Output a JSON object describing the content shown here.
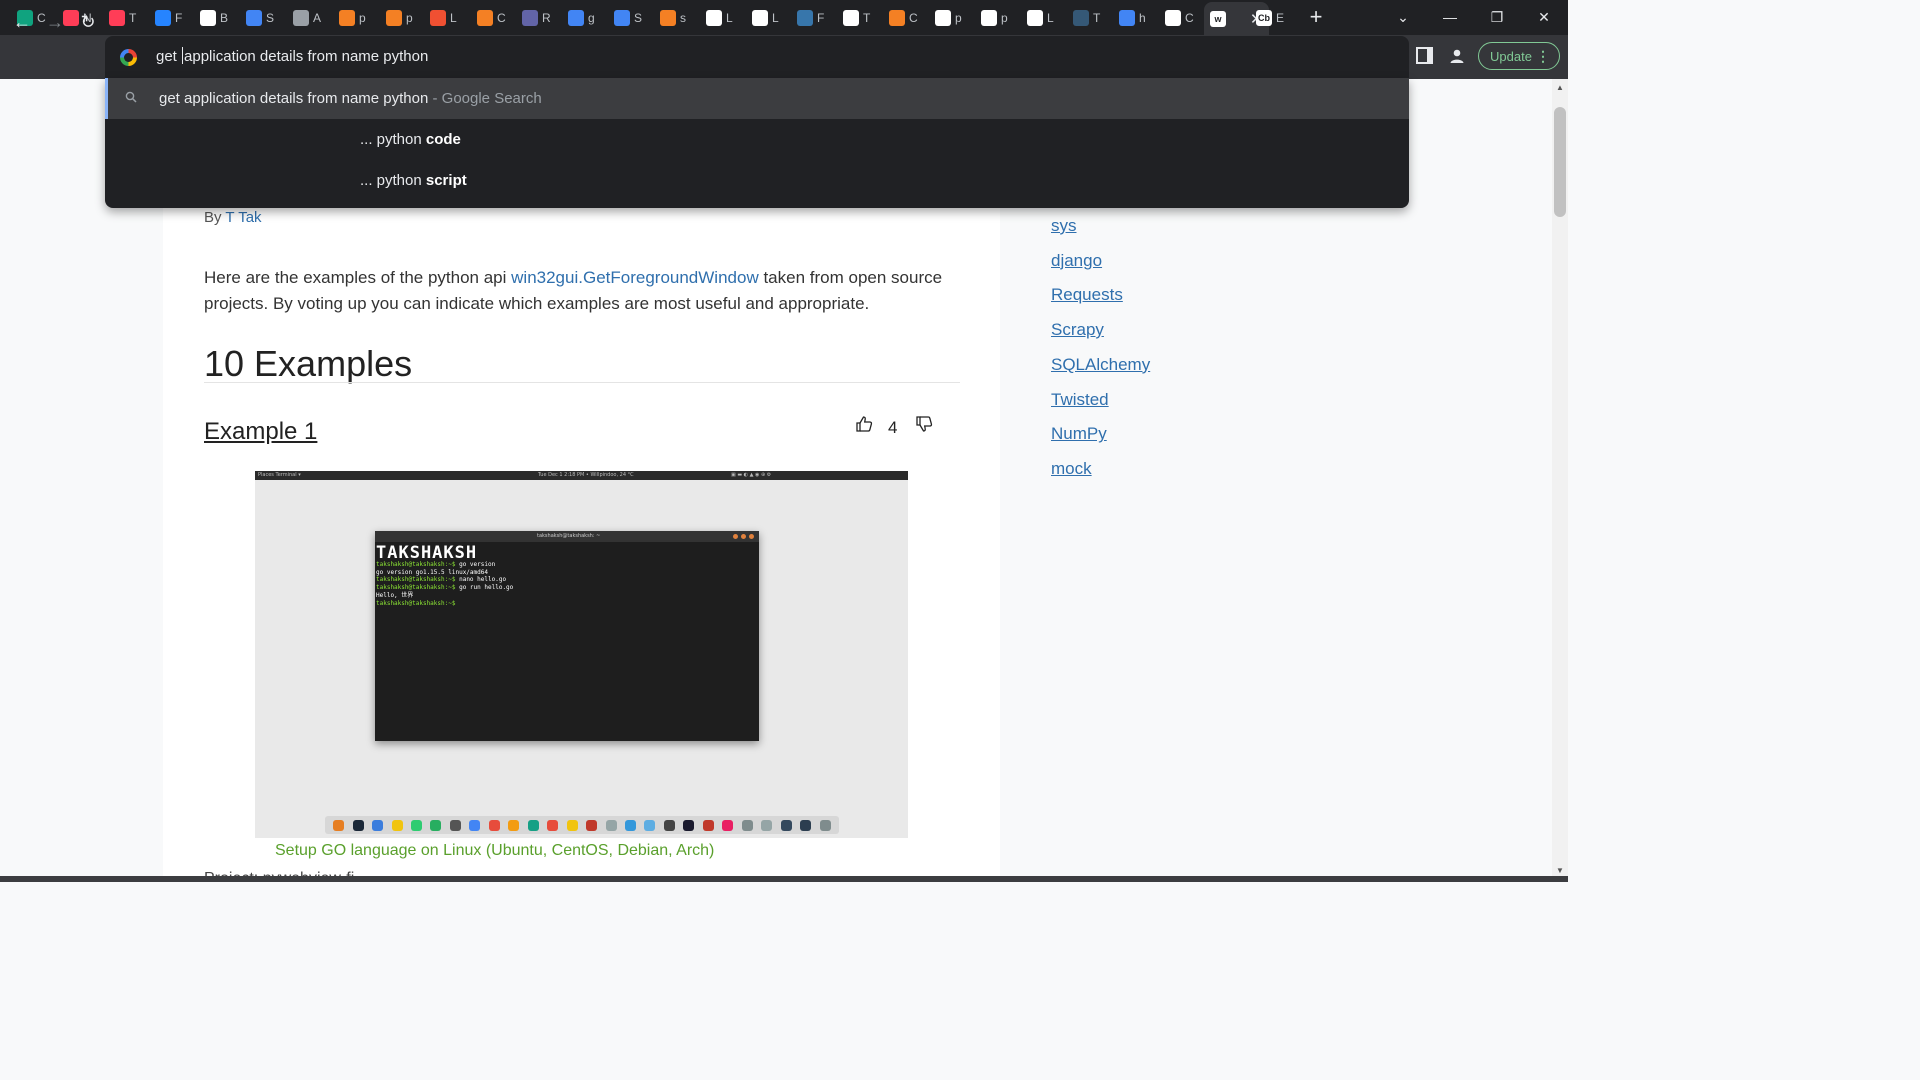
{
  "colors": {
    "chrome_dark": "#202124",
    "toolbar": "#35363a",
    "link": "#2f6fad",
    "caption_green": "#5aa02c",
    "update_green": "#81c995",
    "selected_accent": "#8ab4f8"
  },
  "tabs": [
    {
      "icon": "chatgpt-icon",
      "title": "C",
      "color": "#10a37f"
    },
    {
      "icon": "monday-icon",
      "title": "N",
      "color": "#ff3d57"
    },
    {
      "icon": "monday-icon",
      "title": "T",
      "color": "#ff3d57"
    },
    {
      "icon": "confluence-icon",
      "title": "F",
      "color": "#2684ff"
    },
    {
      "icon": "mail-icon",
      "title": "B",
      "color": "#ffffff"
    },
    {
      "icon": "google-icon",
      "title": "S",
      "color": "#4285f4"
    },
    {
      "icon": "globe-icon",
      "title": "A",
      "color": "#9aa0a6"
    },
    {
      "icon": "stackoverflow-icon",
      "title": "p",
      "color": "#f48024"
    },
    {
      "icon": "stackoverflow-icon",
      "title": "p",
      "color": "#f48024"
    },
    {
      "icon": "git-icon",
      "title": "L",
      "color": "#f05032"
    },
    {
      "icon": "stackoverflow-icon",
      "title": "C",
      "color": "#f48024"
    },
    {
      "icon": "teams-icon",
      "title": "R",
      "color": "#6264a7"
    },
    {
      "icon": "google-icon",
      "title": "g",
      "color": "#4285f4"
    },
    {
      "icon": "google-icon",
      "title": "S",
      "color": "#4285f4"
    },
    {
      "icon": "stackoverflow-icon",
      "title": "s",
      "color": "#f48024"
    },
    {
      "icon": "wikipedia-icon",
      "title": "L",
      "color": "#ffffff"
    },
    {
      "icon": "bold-b-icon",
      "title": "L",
      "color": "#ffffff"
    },
    {
      "icon": "python-icon",
      "title": "F",
      "color": "#3776ab"
    },
    {
      "icon": "medium-icon",
      "title": "T",
      "color": "#ffffff"
    },
    {
      "icon": "stackoverflow-icon",
      "title": "C",
      "color": "#f48024"
    },
    {
      "icon": "github-icon",
      "title": "p",
      "color": "#ffffff"
    },
    {
      "icon": "github-icon",
      "title": "p",
      "color": "#ffffff"
    },
    {
      "icon": "wikipedia-icon",
      "title": "L",
      "color": "#ffffff"
    },
    {
      "icon": "tds-icon",
      "title": "T",
      "color": "#355876"
    },
    {
      "icon": "google-icon",
      "title": "h",
      "color": "#4285f4"
    },
    {
      "icon": "github-icon",
      "title": "C",
      "color": "#ffffff"
    },
    {
      "icon": "w-icon",
      "title": "",
      "color": "#ffffff",
      "active": true,
      "fav_text": "w"
    },
    {
      "icon": "cb-icon",
      "title": "E",
      "color": "#ffffff",
      "fav_text": "Cb"
    }
  ],
  "window": {
    "new_tab": "+",
    "tab_search": "⌄",
    "minimize": "—",
    "restore": "❐",
    "close": "✕"
  },
  "toolbar": {
    "back": "←",
    "forward": "→",
    "reload": "↻",
    "omnibox_before_caret": "get ",
    "omnibox_after_caret": "application details from name python",
    "update_label": "Update"
  },
  "suggestions": [
    {
      "query": "get application details from name python",
      "suffix": " - Google Search",
      "selected": true
    },
    {
      "prefix": "... python ",
      "bold": "code"
    },
    {
      "prefix": "... python ",
      "bold": "script"
    }
  ],
  "article": {
    "byline_prefix": "By ",
    "author": "T Tak",
    "intro_before": "Here are the examples of the python api ",
    "intro_link": "win32gui.GetForegroundWindow",
    "intro_after": " taken from open source projects. By voting up you can indicate which examples are most useful and appropriate.",
    "heading": "10 Examples",
    "example_title": "Example 1",
    "votes": "4",
    "caption": "Setup GO language on Linux (Ubuntu, CentOS, Debian, Arch)",
    "partial_text": "Project: pywebview-fi..."
  },
  "screenshot": {
    "topbar_left": "Places   Terminal ▾",
    "topbar_center": "Tue Dec 1  2:18 PM   •   Willpindoo, 24 °C",
    "topbar_right": "▣ ▬ ◐ ▲ ◉ ⊕ ⚙",
    "terminal_title": "takshaksh@takshaksh: ~",
    "logo": "TAKSHAKSH",
    "lines": [
      {
        "prompt": "takshaksh@takshaksh:~$",
        "cmd": " go version"
      },
      {
        "prompt": "",
        "cmd": "go version go1.15.5 linux/amd64"
      },
      {
        "prompt": "takshaksh@takshaksh:~$",
        "cmd": " nano hello.go"
      },
      {
        "prompt": "takshaksh@takshaksh:~$",
        "cmd": " go run hello.go"
      },
      {
        "prompt": "",
        "cmd": "Hello, 世界"
      },
      {
        "prompt": "takshaksh@takshaksh:~$",
        "cmd": ""
      }
    ]
  },
  "sidebar": [
    "sys",
    "django",
    "Requests",
    "Scrapy",
    "SQLAlchemy",
    "Twisted",
    "NumPy",
    "mock"
  ]
}
